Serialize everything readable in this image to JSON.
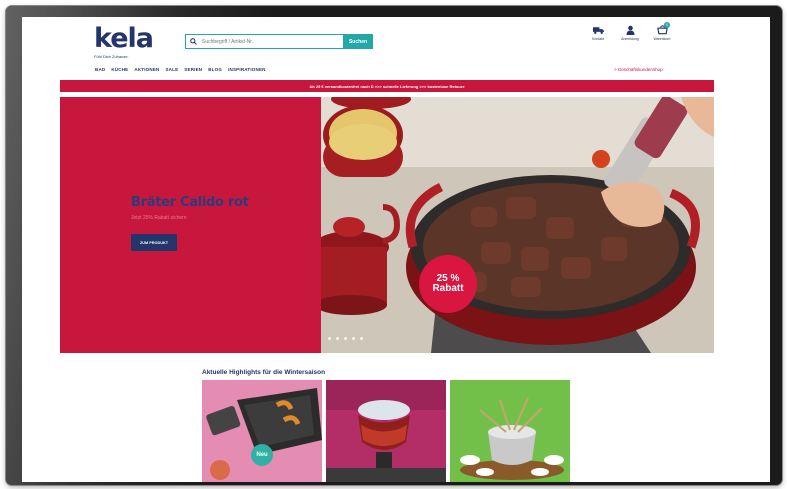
{
  "header": {
    "logo": "kela",
    "tagline": "Fühl Dich Zuhause.",
    "search": {
      "placeholder": "Suchbegriff / Artikel-Nr.",
      "button": "Suchen"
    },
    "icons": [
      {
        "name": "truck-icon",
        "label": "Kontakt"
      },
      {
        "name": "user-icon",
        "label": "Anmeldung"
      },
      {
        "name": "cart-icon",
        "label": "Warenkorb"
      }
    ],
    "cart_count": "0"
  },
  "nav": {
    "items": [
      "BAD",
      "KÜCHE",
      "AKTIONEN",
      "SALE",
      "SERIEN",
      "BLOG",
      "INSPIRATIONEN"
    ],
    "b2b_link": "> Geschäftskundenshop"
  },
  "promo_bar": {
    "text": "Ab 25 € versandkostenfrei nach D >>> schnelle Lieferung >>> kostenlose Retoure"
  },
  "hero": {
    "title": "Bräter Calido rot",
    "subtitle": "Jetzt 25% Rabatt sichern",
    "button": "ZUM PRODUKT",
    "badge_pct": "25 %",
    "badge_word": "Rabatt",
    "slide_count": 5
  },
  "highlights": {
    "title": "Aktuelle Highlights für die Wintersaison",
    "tile1_badge": "Neu"
  },
  "colors": {
    "brand_navy": "#23356b",
    "brand_red": "#c8173d",
    "accent_teal": "#23a7a9"
  }
}
